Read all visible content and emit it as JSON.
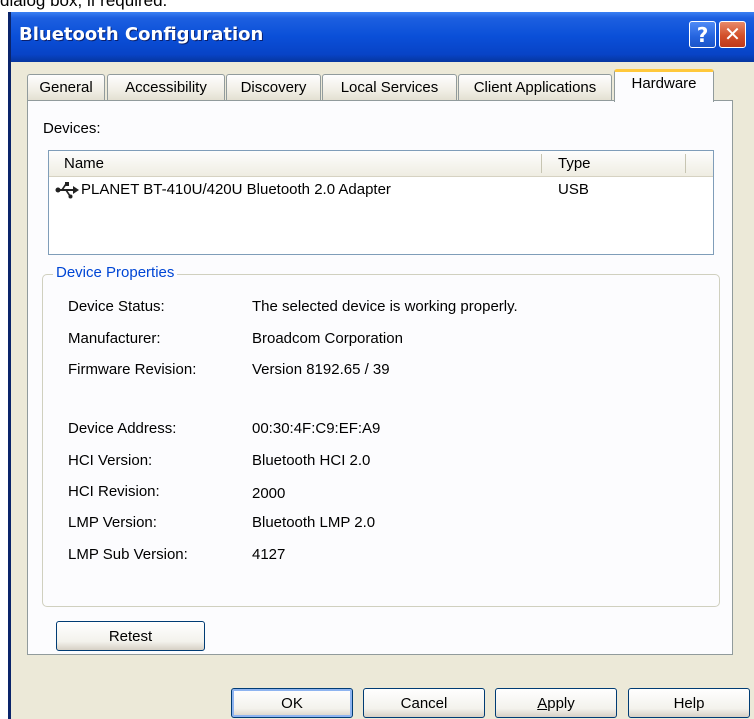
{
  "caption_fragment": "dialog box, if required.",
  "window": {
    "title": "Bluetooth Configuration",
    "help_glyph": "?",
    "close_glyph": "✕"
  },
  "tabs": [
    {
      "label": "General",
      "active": false
    },
    {
      "label": "Accessibility",
      "active": false
    },
    {
      "label": "Discovery",
      "active": false
    },
    {
      "label": "Local Services",
      "active": false
    },
    {
      "label": "Client Applications",
      "active": false
    },
    {
      "label": "Hardware",
      "active": true
    }
  ],
  "hardware": {
    "devices_label": "Devices:",
    "columns": {
      "name": "Name",
      "type": "Type"
    },
    "devices": [
      {
        "icon": "usb-icon",
        "name": "PLANET BT-410U/420U Bluetooth 2.0 Adapter",
        "type": "USB"
      }
    ],
    "properties_title": "Device Properties",
    "properties": [
      {
        "label": "Device Status:",
        "value": "The selected device is working properly."
      },
      {
        "label": "Manufacturer:",
        "value": "Broadcom Corporation"
      },
      {
        "label": "Firmware Revision:",
        "value": "Version 8192.65 / 39"
      },
      {
        "label": "Device Address:",
        "value": "00:30:4F:C9:EF:A9"
      },
      {
        "label": "HCI Version:",
        "value": "Bluetooth HCI 2.0"
      },
      {
        "label": "HCI Revision:",
        "value": "2000"
      },
      {
        "label": "LMP Version:",
        "value": "Bluetooth LMP 2.0"
      },
      {
        "label": "LMP Sub Version:",
        "value": "4127"
      }
    ],
    "retest_label": "Retest"
  },
  "buttons": {
    "ok": "OK",
    "cancel": "Cancel",
    "apply_accel": "A",
    "apply_rest": "pply",
    "help": "Help"
  },
  "colors": {
    "title_bar": "#0a4fd8",
    "active_tab_accent": "#ffc83c",
    "group_title": "#0046d5",
    "dialog_face": "#ece9d8"
  }
}
